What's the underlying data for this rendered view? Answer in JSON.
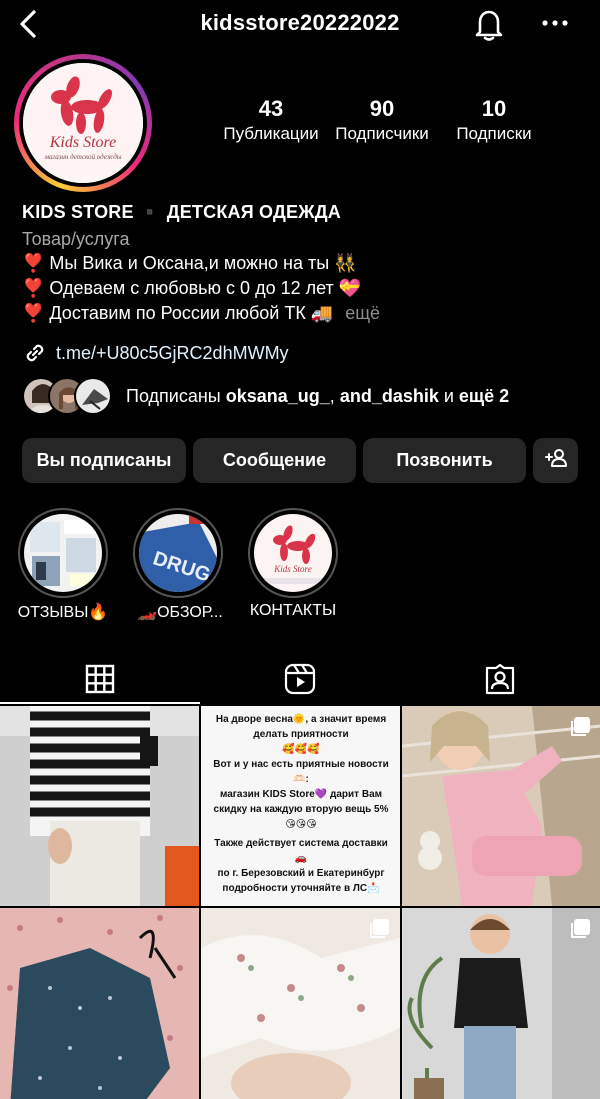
{
  "header": {
    "username": "kidsstore20222022",
    "back_icon": "chevron-left-icon",
    "bell_icon": "bell-icon",
    "more_icon": "more-horizontal-icon"
  },
  "profile": {
    "avatar_logo_text": "Kids Store",
    "avatar_logo_subtitle": "магазин детской одежды",
    "stats": [
      {
        "num": "43",
        "label": "Публикации"
      },
      {
        "num": "90",
        "label": "Подписчики"
      },
      {
        "num": "10",
        "label": "Подписки"
      }
    ]
  },
  "bio": {
    "name": "KIDS STORE ▪️ ДЕТСКАЯ ОДЕЖДА",
    "category": "Товар/услуга",
    "lines": [
      "❣️ Мы Вика и Оксана,и можно на ты 👯‍♀️",
      "❣️ Одеваем с любовью с 0 до 12 лет 💝",
      "❣️ Доставим по России любой ТК 🚚"
    ],
    "more": "ещё",
    "link": "t.me/+U80c5GjRC2dhMWMy"
  },
  "followed_by": {
    "prefix": "Подписаны ",
    "user1": "oksana_ug_",
    "sep": ", ",
    "user2": "and_dashik",
    "and": " и ",
    "more": "ещё 2"
  },
  "buttons": {
    "following": "Вы подписаны",
    "message": "Сообщение",
    "call": "Позвонить",
    "add_user_icon": "add-person-icon"
  },
  "highlights": [
    {
      "label": "ОТЗЫВЫ🔥"
    },
    {
      "label": "🏎️ОБЗОР..."
    },
    {
      "label": "КОНТАКТЫ"
    }
  ],
  "highlight_logo_caption": "Kids Store",
  "tabs": [
    {
      "icon": "grid-icon",
      "active": true
    },
    {
      "icon": "reels-icon",
      "active": false
    },
    {
      "icon": "tagged-icon",
      "active": false
    }
  ],
  "post_text": {
    "lines": [
      "На дворе весна🌞, а значит время",
      "делать приятности",
      "🥰🥰🥰",
      "Вот и у нас есть приятные новости 🫶🏻:",
      "магазин KIDS Store💜 дарит Вам",
      "скидку на каждую вторую вещь 5%",
      "😘😘😘",
      "",
      "Также действует система доставки🚗",
      "по г. Березовский и Екатеринбург",
      "подробности уточняйте в ЛС📩"
    ]
  }
}
